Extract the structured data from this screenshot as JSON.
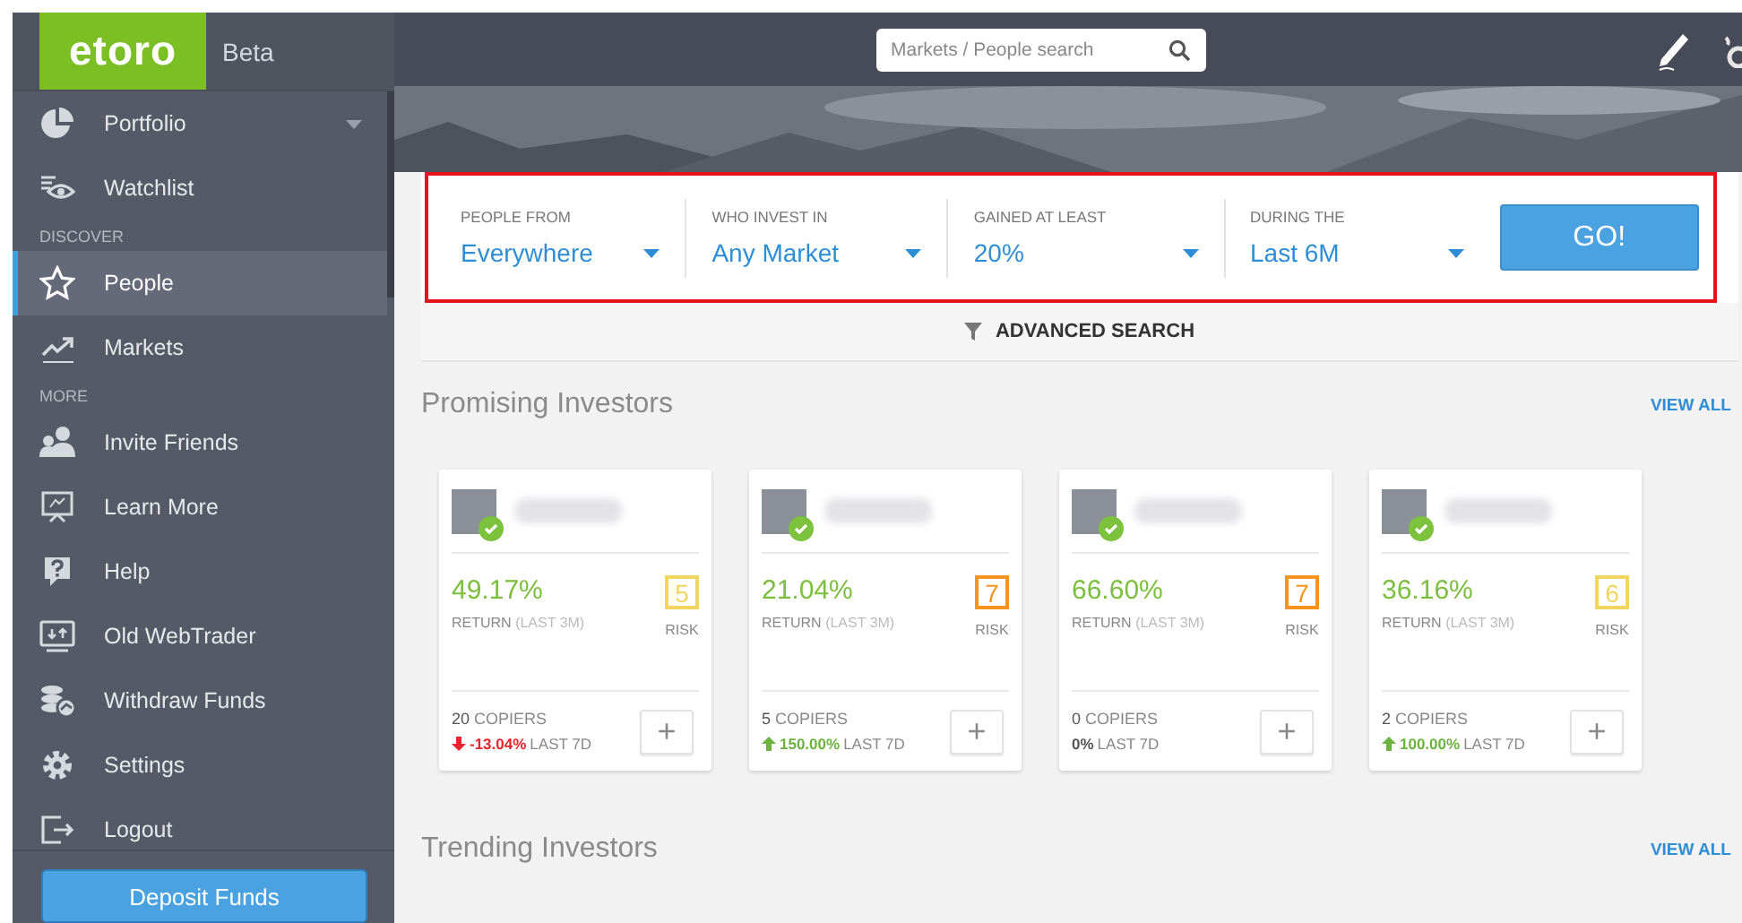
{
  "brand": {
    "logo": "etoro",
    "tag": "Beta"
  },
  "sidebar": {
    "items": [
      {
        "kind": "item",
        "label": "Portfolio",
        "selected": false,
        "expanded": false
      },
      {
        "kind": "item",
        "label": "Watchlist",
        "selected": false
      },
      {
        "kind": "header",
        "label": "DISCOVER"
      },
      {
        "kind": "item",
        "label": "People",
        "selected": true
      },
      {
        "kind": "item",
        "label": "Markets",
        "selected": false
      },
      {
        "kind": "header",
        "label": "MORE"
      },
      {
        "kind": "item",
        "label": "Invite Friends",
        "selected": false
      },
      {
        "kind": "item",
        "label": "Learn More",
        "selected": false
      },
      {
        "kind": "item",
        "label": "Help",
        "selected": false
      },
      {
        "kind": "item",
        "label": "Old WebTrader",
        "selected": false
      },
      {
        "kind": "item",
        "label": "Withdraw Funds",
        "selected": false
      },
      {
        "kind": "item",
        "label": "Settings",
        "selected": false
      },
      {
        "kind": "item",
        "label": "Logout",
        "selected": false
      }
    ],
    "deposit_button": "Deposit Funds"
  },
  "topbar": {
    "search": {
      "placeholder": "Markets / People search"
    }
  },
  "filters": [
    {
      "label": "PEOPLE FROM",
      "value": "Everywhere"
    },
    {
      "label": "WHO INVEST IN",
      "value": "Any Market"
    },
    {
      "label": "GAINED AT LEAST",
      "value": "20%"
    },
    {
      "label": "DURING THE",
      "value": "Last 6M"
    }
  ],
  "go_button": "GO!",
  "advanced_search": "ADVANCED SEARCH",
  "sections": [
    {
      "title": "Promising Investors",
      "link": "VIEW ALL",
      "cards": [
        {
          "return": "49.17%",
          "return_label": "RETURN",
          "period": "(LAST 3M)",
          "risk": {
            "value": "5",
            "color": "#f2d55c"
          },
          "risk_label": "RISK",
          "copiers": "20",
          "copiers_label": "COPIERS",
          "change": {
            "value": "-13.04%",
            "kind": "down"
          },
          "change_label": "LAST 7D",
          "add": "+"
        },
        {
          "return": "21.04%",
          "return_label": "RETURN",
          "period": "(LAST 3M)",
          "risk": {
            "value": "7",
            "color": "#f7941d"
          },
          "risk_label": "RISK",
          "copiers": "5",
          "copiers_label": "COPIERS",
          "change": {
            "value": "150.00%",
            "kind": "up"
          },
          "change_label": "LAST 7D",
          "add": "+"
        },
        {
          "return": "66.60%",
          "return_label": "RETURN",
          "period": "(LAST 3M)",
          "risk": {
            "value": "7",
            "color": "#f7941d"
          },
          "risk_label": "RISK",
          "copiers": "0",
          "copiers_label": "COPIERS",
          "change": {
            "value": "0%",
            "kind": "flat"
          },
          "change_label": "LAST 7D",
          "add": "+"
        },
        {
          "return": "36.16%",
          "return_label": "RETURN",
          "period": "(LAST 3M)",
          "risk": {
            "value": "6",
            "color": "#f2d55c"
          },
          "risk_label": "RISK",
          "copiers": "2",
          "copiers_label": "COPIERS",
          "change": {
            "value": "100.00%",
            "kind": "up"
          },
          "change_label": "LAST 7D",
          "add": "+"
        }
      ]
    },
    {
      "title": "Trending Investors",
      "link": "VIEW ALL"
    }
  ]
}
